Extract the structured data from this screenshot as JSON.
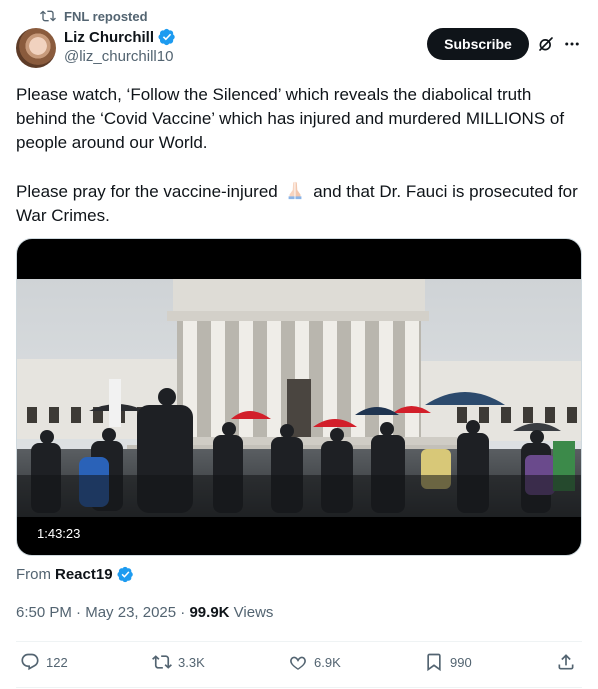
{
  "repost": {
    "label": "FNL reposted",
    "icon": "repost-icon"
  },
  "author": {
    "name": "Liz Churchill",
    "handle": "@liz_churchill10",
    "verified": true
  },
  "header": {
    "subscribe_label": "Subscribe",
    "grok_icon": "grok-icon",
    "more_icon": "more-icon"
  },
  "tweet": {
    "paragraph1": "Please watch, ‘Follow the Silenced’ which reveals the diabolical truth behind the ‘Covid Vaccine’ which has injured and murdered MILLIONS of people around our World.",
    "paragraph2_before": "Please pray for the vaccine-injured",
    "paragraph2_emoji": "folded-hands-emoji",
    "paragraph2_after": "and that Dr. Fauci is prosecuted for War Crimes."
  },
  "media": {
    "duration": "1:43:23"
  },
  "source": {
    "prefix": "From",
    "account": "React19"
  },
  "meta": {
    "time": "6:50 PM",
    "separator": "·",
    "date": "May 23, 2025",
    "views_count": "99.9K",
    "views_label": "Views"
  },
  "actions": {
    "replies": "122",
    "reposts": "3.3K",
    "likes": "6.9K",
    "bookmarks": "990"
  },
  "colors": {
    "accent": "#1d9bf0",
    "text": "#0f1419",
    "secondary": "#536471",
    "button": "#0f1419"
  }
}
